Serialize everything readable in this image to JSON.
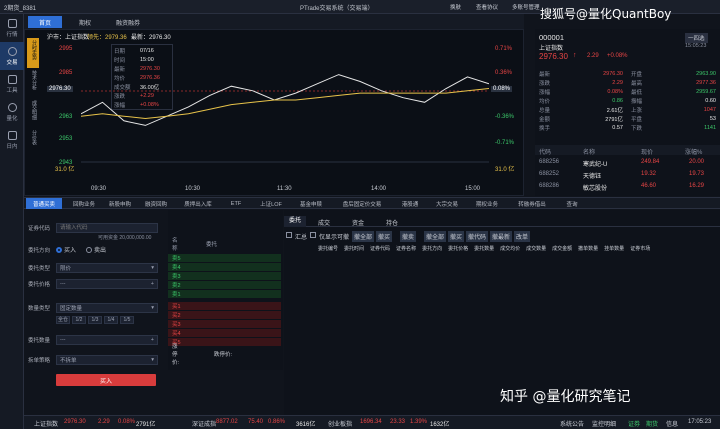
{
  "window": {
    "title": "PTrade交易系统（交易端）",
    "account": "2期货_8381",
    "links": [
      "换肤",
      "查看协议",
      "多账号管理"
    ]
  },
  "left_tools": [
    "行情",
    "交易",
    "工具",
    "量化",
    "日内"
  ],
  "top_tabs": [
    "首页",
    "期权",
    "融资融券"
  ],
  "chart": {
    "code_name": "沪市：上证指数",
    "lead_label": "领先：2979.36",
    "latest_label": "最新：2976.30",
    "price_axis": [
      "2995",
      "2985",
      "2976.30",
      "2963",
      "2953",
      "2943"
    ],
    "pct_axis": [
      "0.71%",
      "0.36%",
      "0.08%",
      "-0.36%",
      "-0.71%"
    ],
    "vol_label": "31.0 亿",
    "vol_label2": "31.0 亿",
    "time_axis": [
      "09:30",
      "10:30",
      "11:30",
      "14:00",
      "15:00"
    ],
    "left_badges": [
      "分时走势",
      "技术分析",
      "成交明细",
      "分价表"
    ],
    "info": [
      [
        "日期",
        "07/16"
      ],
      [
        "时间",
        "15:00"
      ],
      [
        "最新",
        "2976.30"
      ],
      [
        "均价",
        "2976.36"
      ],
      [
        "成交额",
        "36.00亿"
      ],
      [
        "涨跌",
        "+2.29"
      ],
      [
        "涨幅",
        "+0.08%"
      ]
    ],
    "chart_data": {
      "type": "line",
      "series": [
        {
          "values": [
            2963,
            2968,
            2960,
            2958,
            2962,
            2966,
            2971,
            2975,
            2973,
            2969,
            2972,
            2976,
            2980,
            2977,
            2973,
            2970,
            2968,
            2974,
            2979,
            2976
          ]
        },
        {
          "values": [
            2962,
            2963,
            2962,
            2961,
            2962,
            2963,
            2965,
            2967,
            2968,
            2969,
            2969,
            2970,
            2971,
            2972,
            2972,
            2972,
            2972,
            2972,
            2973,
            2974
          ]
        }
      ],
      "ylim": [
        2943,
        2995
      ]
    }
  },
  "quote": {
    "code": "000001",
    "name": "上证指数",
    "price": "2976.30",
    "arrow": "↑",
    "change": "2.29",
    "pct": "+0.08%",
    "btn": "一四选",
    "time": "15:05:23",
    "rows": [
      [
        "最新",
        "2976.30",
        "开盘",
        "2963.90"
      ],
      [
        "涨跌",
        "2.29",
        "最高",
        "2977.36"
      ],
      [
        "涨幅",
        "0.08%",
        "最低",
        "2959.67"
      ],
      [
        "均价",
        "0.86",
        "振幅",
        "0.60"
      ],
      [
        "总量",
        "2.61亿",
        "上涨",
        "1047"
      ],
      [
        "金额",
        "2791亿",
        "平盘",
        "53"
      ],
      [
        "换手",
        "0.57",
        "下跌",
        "1141"
      ]
    ],
    "list_header": [
      "代码",
      "名称",
      "现价",
      "涨幅%"
    ],
    "list": [
      [
        "688256",
        "寒武纪-U",
        "249.84",
        "20.00"
      ],
      [
        "688252",
        "天德钰",
        "19.32",
        "19.73"
      ],
      [
        "688286",
        "敏芯股份",
        "46.60",
        "16.29"
      ]
    ]
  },
  "mid_tabs": [
    "普通买卖",
    "回购业务",
    "新股申购",
    "融资回购",
    "质押出入库",
    "ETF",
    "上证LOF",
    "基金申赎",
    "盘后固定价交易",
    "港股通",
    "大宗交易",
    "期权业务",
    "转融券借出",
    "查询"
  ],
  "order": {
    "code_label": "证券代码",
    "code_ph": "请输入代码",
    "avail_label": "可用资金",
    "avail": "20,000,000.00",
    "dir_label": "委托方向",
    "buy": "买入",
    "sell": "卖出",
    "type_label": "委托类型",
    "type_val": "限价",
    "price_label": "委托价格",
    "price_val": "---",
    "qty_type_label": "数量类型",
    "qty_type_val": "固定数量",
    "qty_btns": [
      "全仓",
      "1/2",
      "1/3",
      "1/4",
      "1/5"
    ],
    "qty_label": "委托数量",
    "qty_val": "---",
    "split_label": "拆单策略",
    "split_val": "不拆单",
    "submit": "买入"
  },
  "book": {
    "header": [
      "名称",
      "委托"
    ],
    "asks": [
      "卖5",
      "卖4",
      "卖3",
      "卖2",
      "卖1"
    ],
    "bids": [
      "买1",
      "买2",
      "买3",
      "买4",
      "买5"
    ],
    "limit_up": "涨停价:",
    "limit_down": "跌停价:"
  },
  "right": {
    "tabs": [
      "委托",
      "成交",
      "资金",
      "持仓"
    ],
    "filters": [
      "汇总",
      "仅显示可撤",
      "撤全部",
      "撤买",
      "撤卖",
      "撤全部",
      "撤买",
      "撤代码",
      "撤最新",
      "改单"
    ],
    "cols": [
      "委托编号",
      "委托时间",
      "证券代码",
      "证券名称",
      "委托方向",
      "委托价格",
      "委托数量",
      "成交均价",
      "成交数量",
      "成交金额",
      "撤单数量",
      "挂单数量",
      "证券市场"
    ]
  },
  "status": {
    "items": [
      "上证指数",
      "2976.30",
      "2.29",
      "0.08%",
      "2791亿",
      "深证成指",
      "8877.02",
      "75.40",
      "0.86%",
      "3616亿",
      "创业板指",
      "1696.34",
      "23.33",
      "1.39%",
      "1632亿"
    ],
    "right": [
      "系统公告",
      "监控明细",
      "证券",
      "期货",
      "信息",
      "17:05:23"
    ]
  },
  "watermark": {
    "top": "搜狐号@量化QuantBoy",
    "bottom": "知乎 @量化研究笔记"
  }
}
